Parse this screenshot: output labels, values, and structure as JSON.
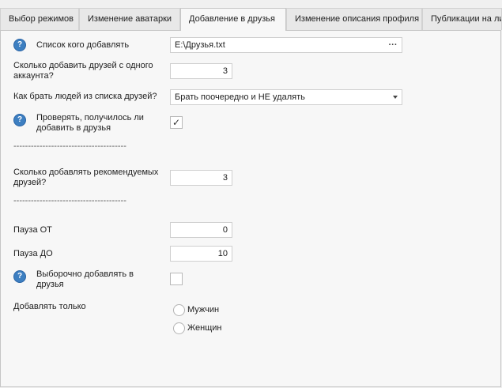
{
  "tabs": [
    {
      "label": "Выбор режимов",
      "active": false
    },
    {
      "label": "Изменение аватарки",
      "active": false
    },
    {
      "label": "Добавление в друзья",
      "active": true
    },
    {
      "label": "Изменение описания профиля",
      "active": false
    },
    {
      "label": "Публикации на ли",
      "active": false
    }
  ],
  "form": {
    "friends_list_label": "Список кого добавлять",
    "friends_list_value": "E:\\Друзья.txt",
    "browse_button": "···",
    "count_per_account_label": "Сколько добавить друзей с одного аккаунта?",
    "count_per_account_value": "3",
    "pick_method_label": "Как брать людей из списка друзей?",
    "pick_method_value": "Брать поочередно и НЕ удалять",
    "check_added_label": "Проверять, получилось ли добавить в друзья",
    "check_added_checked": true,
    "separator_1": "---------------------------------------",
    "recommended_count_label": "Сколько добавлять рекомендуемых друзей?",
    "recommended_count_value": "3",
    "separator_2": "---------------------------------------",
    "pause_from_label": "Пауза ОТ",
    "pause_from_value": "0",
    "pause_to_label": "Пауза ДО",
    "pause_to_value": "10",
    "selective_add_label": "Выборочно добавлять в друзья",
    "selective_add_checked": false,
    "add_only_label": "Добавлять только",
    "gender_options": [
      "Мужчин",
      "Женщин"
    ]
  },
  "icons": {
    "help": "help-circle-icon",
    "check": "checkmark-icon"
  },
  "colors": {
    "help_icon": "#3d7fc1",
    "active_tab": "#f7f7f7",
    "background": "#f0f0f0"
  }
}
